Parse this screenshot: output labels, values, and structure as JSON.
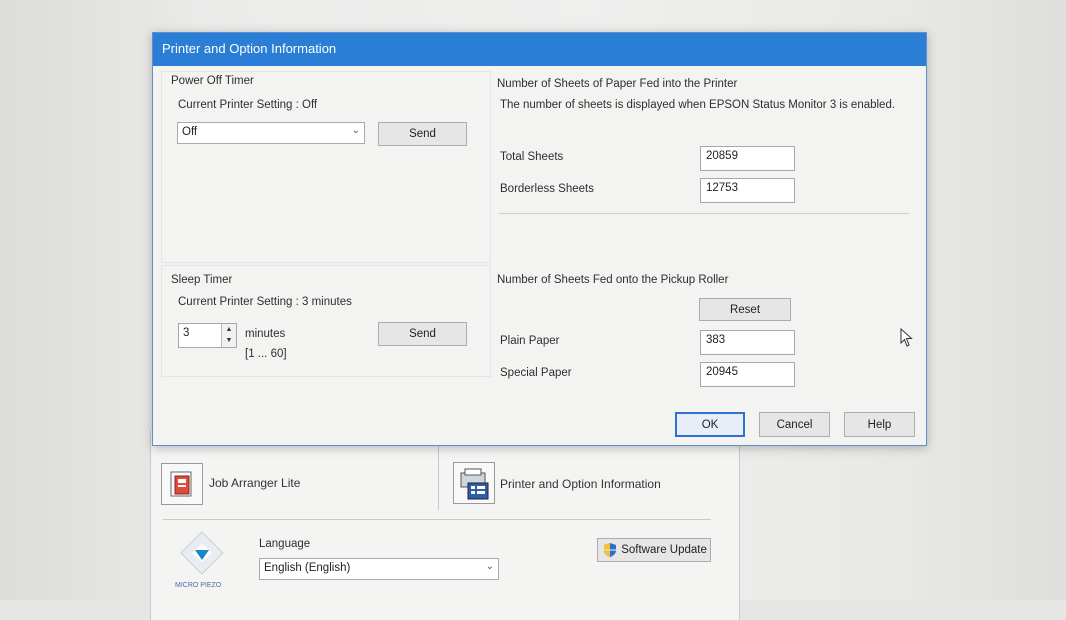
{
  "dialog": {
    "title": "Printer and Option Information",
    "power_off": {
      "heading": "Power Off Timer",
      "current_setting": "Current Printer Setting : Off",
      "select_value": "Off",
      "send_label": "Send"
    },
    "sleep": {
      "heading": "Sleep Timer",
      "current_setting": "Current Printer Setting : 3 minutes",
      "value": "3",
      "unit": "minutes",
      "range": "[1 ... 60]",
      "send_label": "Send"
    },
    "paper_fed": {
      "heading": "Number of Sheets of Paper Fed into the Printer",
      "note": "The number of sheets is displayed when EPSON Status Monitor 3 is enabled.",
      "total_label": "Total Sheets",
      "total_value": "20859",
      "borderless_label": "Borderless Sheets",
      "borderless_value": "12753"
    },
    "pickup_roller": {
      "heading": "Number of Sheets Fed onto the Pickup Roller",
      "reset_label": "Reset",
      "plain_label": "Plain Paper",
      "plain_value": "383",
      "special_label": "Special Paper",
      "special_value": "20945"
    },
    "ok_label": "OK",
    "cancel_label": "Cancel",
    "help_label": "Help"
  },
  "main": {
    "job_arranger_label": "Job Arranger Lite",
    "printer_info_label": "Printer and Option Information",
    "language_label": "Language",
    "language_value": "English (English)",
    "software_update_label": "Software Update",
    "logo_text": "MICRO PIEZO"
  },
  "colors": {
    "title_bar": "#2a7ed6",
    "default_button_border": "#2b73cc"
  }
}
